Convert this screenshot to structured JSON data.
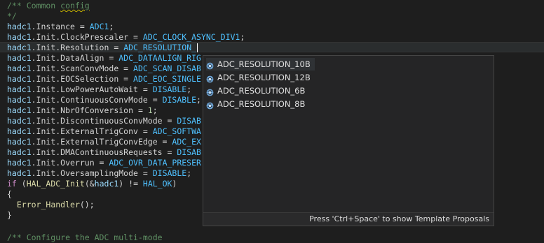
{
  "editor": {
    "lines": [
      {
        "seg": [
          {
            "c": "cm",
            "t": "/** Common "
          },
          {
            "c": "cm sq",
            "t": "config"
          }
        ]
      },
      {
        "seg": [
          {
            "c": "cm",
            "t": "*/"
          }
        ]
      },
      {
        "seg": [
          {
            "c": "fld",
            "t": "hadc1"
          },
          {
            "c": "",
            "t": ".Instance = "
          },
          {
            "c": "mac",
            "t": "ADC1"
          },
          {
            "c": "",
            "t": ";"
          }
        ]
      },
      {
        "seg": [
          {
            "c": "fld",
            "t": "hadc1"
          },
          {
            "c": "",
            "t": ".Init.ClockPrescaler = "
          },
          {
            "c": "mac",
            "t": "ADC_CLOCK_ASYNC_DIV1"
          },
          {
            "c": "",
            "t": ";"
          }
        ]
      },
      {
        "seg": [
          {
            "c": "fld",
            "t": "hadc1"
          },
          {
            "c": "",
            "t": ".Init.Resolution = "
          },
          {
            "c": "mac",
            "t": "ADC_RESOLUTION_"
          }
        ],
        "current": true
      },
      {
        "seg": [
          {
            "c": "fld",
            "t": "hadc1"
          },
          {
            "c": "",
            "t": ".Init.DataAlign = "
          },
          {
            "c": "mac",
            "t": "ADC_DATAALIGN_RIG"
          }
        ]
      },
      {
        "seg": [
          {
            "c": "fld",
            "t": "hadc1"
          },
          {
            "c": "",
            "t": ".Init.ScanConvMode = "
          },
          {
            "c": "mac",
            "t": "ADC_SCAN_DISAB"
          }
        ]
      },
      {
        "seg": [
          {
            "c": "fld",
            "t": "hadc1"
          },
          {
            "c": "",
            "t": ".Init.EOCSelection = "
          },
          {
            "c": "mac",
            "t": "ADC_EOC_SINGLE"
          }
        ]
      },
      {
        "seg": [
          {
            "c": "fld",
            "t": "hadc1"
          },
          {
            "c": "",
            "t": ".Init.LowPowerAutoWait = "
          },
          {
            "c": "mac",
            "t": "DISABLE"
          },
          {
            "c": "",
            "t": ";"
          }
        ]
      },
      {
        "seg": [
          {
            "c": "fld",
            "t": "hadc1"
          },
          {
            "c": "",
            "t": ".Init.ContinuousConvMode = "
          },
          {
            "c": "mac",
            "t": "DISABLE"
          },
          {
            "c": "",
            "t": ";"
          }
        ]
      },
      {
        "seg": [
          {
            "c": "fld",
            "t": "hadc1"
          },
          {
            "c": "",
            "t": ".Init.NbrOfConversion = "
          },
          {
            "c": "num",
            "t": "1"
          },
          {
            "c": "",
            "t": ";"
          }
        ]
      },
      {
        "seg": [
          {
            "c": "fld",
            "t": "hadc1"
          },
          {
            "c": "",
            "t": ".Init.DiscontinuousConvMode = "
          },
          {
            "c": "mac",
            "t": "DISAB"
          }
        ]
      },
      {
        "seg": [
          {
            "c": "fld",
            "t": "hadc1"
          },
          {
            "c": "",
            "t": ".Init.ExternalTrigConv = "
          },
          {
            "c": "mac",
            "t": "ADC_SOFTWA"
          }
        ]
      },
      {
        "seg": [
          {
            "c": "fld",
            "t": "hadc1"
          },
          {
            "c": "",
            "t": ".Init.ExternalTrigConvEdge = "
          },
          {
            "c": "mac",
            "t": "ADC_EX"
          }
        ]
      },
      {
        "seg": [
          {
            "c": "fld",
            "t": "hadc1"
          },
          {
            "c": "",
            "t": ".Init.DMAContinuousRequests = "
          },
          {
            "c": "mac",
            "t": "DISAB"
          }
        ]
      },
      {
        "seg": [
          {
            "c": "fld",
            "t": "hadc1"
          },
          {
            "c": "",
            "t": ".Init.Overrun = "
          },
          {
            "c": "mac",
            "t": "ADC_OVR_DATA_PRESER"
          }
        ]
      },
      {
        "seg": [
          {
            "c": "fld",
            "t": "hadc1"
          },
          {
            "c": "",
            "t": ".Init.OversamplingMode = "
          },
          {
            "c": "mac",
            "t": "DISABLE"
          },
          {
            "c": "",
            "t": ";"
          }
        ]
      },
      {
        "seg": [
          {
            "c": "kw",
            "t": "if"
          },
          {
            "c": "",
            "t": " ("
          },
          {
            "c": "fn",
            "t": "HAL_ADC_Init"
          },
          {
            "c": "",
            "t": "(&"
          },
          {
            "c": "fld",
            "t": "hadc1"
          },
          {
            "c": "",
            "t": ") != "
          },
          {
            "c": "mac",
            "t": "HAL_OK"
          },
          {
            "c": "",
            "t": ")"
          }
        ]
      },
      {
        "seg": [
          {
            "c": "",
            "t": "{"
          }
        ]
      },
      {
        "seg": [
          {
            "c": "",
            "t": "  "
          },
          {
            "c": "fn",
            "t": "Error_Handler"
          },
          {
            "c": "",
            "t": "();"
          }
        ]
      },
      {
        "seg": [
          {
            "c": "",
            "t": "}"
          }
        ]
      },
      {
        "seg": [
          {
            "c": "",
            "t": ""
          }
        ]
      },
      {
        "seg": [
          {
            "c": "cm",
            "t": "/** Configure the ADC multi-mode"
          }
        ]
      }
    ]
  },
  "autocomplete": {
    "items": [
      {
        "label": "ADC_RESOLUTION_10B",
        "selected": true,
        "icon": "macro-icon"
      },
      {
        "label": "ADC_RESOLUTION_12B",
        "selected": false,
        "icon": "macro-icon"
      },
      {
        "label": "ADC_RESOLUTION_6B",
        "selected": false,
        "icon": "macro-icon"
      },
      {
        "label": "ADC_RESOLUTION_8B",
        "selected": false,
        "icon": "macro-icon"
      }
    ],
    "footer": "Press 'Ctrl+Space' to show Template Proposals"
  },
  "colors": {
    "background": "#1e1e1e",
    "popup_background": "#252526",
    "comment": "#5f8f63",
    "keyword": "#c586c0",
    "variable": "#9cdcfe",
    "macro": "#4fc1ff",
    "number": "#b5cea8",
    "function": "#dcdcaa"
  }
}
